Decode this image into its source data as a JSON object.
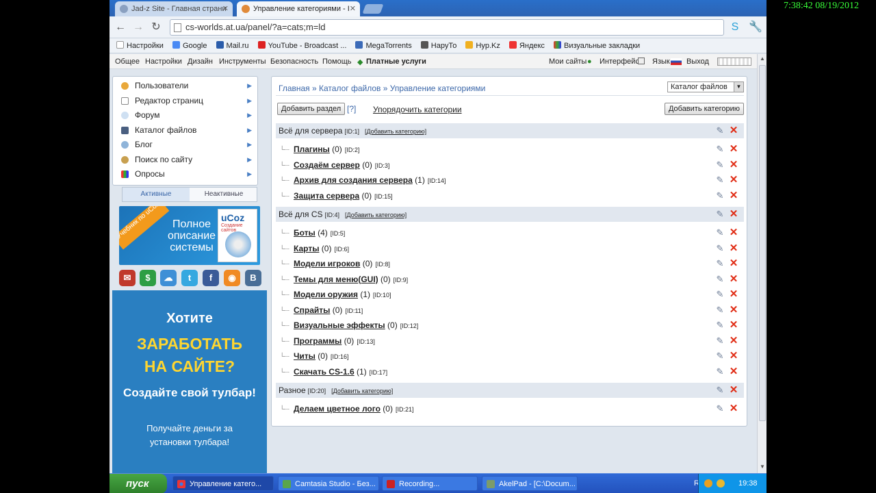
{
  "clock": "7:38:42  08/19/2012",
  "browser": {
    "tabs": [
      {
        "title": "Jad-z Site - Главная страни"
      },
      {
        "title": "Управление категориями - I"
      }
    ],
    "url": "cs-worlds.at.ua/panel/?a=cats;m=ld",
    "bookmarks": [
      "Настройки",
      "Google",
      "Mail.ru",
      "YouTube - Broadcast ...",
      "MegaTorrents",
      "НаруТо",
      "Hyp.Kz",
      "Яндекс",
      "Визуальные закладки"
    ]
  },
  "panelnav": {
    "items": [
      "Общее",
      "Настройки",
      "Дизайн",
      "Инструменты",
      "Безопасность",
      "Помощь"
    ],
    "paid": "Платные услуги",
    "right": [
      "Мои сайты",
      "Интерфейс",
      "Язык",
      "Выход"
    ]
  },
  "leftmenu": {
    "items": [
      "Пользователи",
      "Редактор страниц",
      "Форум",
      "Каталог файлов",
      "Блог",
      "Поиск по сайту",
      "Опросы"
    ],
    "tabs": {
      "active": "Активные",
      "inactive": "Неактивные"
    }
  },
  "banner": {
    "ribbon": "Учебник по uCoz",
    "text": "Полное описание системы",
    "logo": "uCoz",
    "sub": "Создание сайтов"
  },
  "socials": [
    "envelope",
    "dollar",
    "cloud",
    "twitter",
    "f",
    "rss",
    "В"
  ],
  "promo": {
    "line1": "Хотите",
    "line2": "ЗАРАБОТАТЬ",
    "line3": "НА САЙТЕ?",
    "line4": "Создайте свой тулбар!",
    "line5": "Получайте деньги за",
    "line6": "установки тулбара!"
  },
  "main": {
    "crumbs": "Главная » Каталог файлов » Управление категориями",
    "select": "Каталог файлов",
    "add_section": "Добавить раздел",
    "help": "[?]",
    "sort": "Упорядочить категории",
    "add_category": "Добавить категорию",
    "add_link": "[Добавить категорию]",
    "sections": [
      {
        "name": "Всё для сервера",
        "id": "[ID:1]",
        "cats": [
          {
            "name": "Плагины",
            "count": "(0)",
            "id": "[ID:2]"
          },
          {
            "name": "Создаём сервер",
            "count": "(0)",
            "id": "[ID:3]"
          },
          {
            "name": "Архив для создания сервера",
            "count": "(1)",
            "id": "[ID:14]"
          },
          {
            "name": "Защита сервера",
            "count": "(0)",
            "id": "[ID:15]"
          }
        ]
      },
      {
        "name": "Всё для CS",
        "id": "[ID:4]",
        "cats": [
          {
            "name": "Боты",
            "count": "(4)",
            "id": "[ID:5]"
          },
          {
            "name": "Карты",
            "count": "(0)",
            "id": "[ID:6]"
          },
          {
            "name": "Модели игроков",
            "count": "(0)",
            "id": "[ID:8]"
          },
          {
            "name": "Темы для меню(GUI)",
            "count": "(0)",
            "id": "[ID:9]"
          },
          {
            "name": "Модели оружия",
            "count": "(1)",
            "id": "[ID:10]"
          },
          {
            "name": "Спрайты",
            "count": "(0)",
            "id": "[ID:11]"
          },
          {
            "name": "Визуальные эффекты",
            "count": "(0)",
            "id": "[ID:12]"
          },
          {
            "name": "Программы",
            "count": "(0)",
            "id": "[ID:13]"
          },
          {
            "name": "Читы",
            "count": "(0)",
            "id": "[ID:16]"
          },
          {
            "name": "Скачать CS-1.6",
            "count": "(1)",
            "id": "[ID:17]"
          }
        ]
      },
      {
        "name": "Разное",
        "id": "[ID:20]",
        "cats": [
          {
            "name": "Делаем цветное лого",
            "count": "(0)",
            "id": "[ID:21]"
          }
        ]
      }
    ]
  },
  "taskbar": {
    "start": "пуск",
    "tasks": [
      "Управление катего...",
      "Camtasia Studio - Без...",
      "Recording...",
      "AkelPad - [C:\\Docum..."
    ],
    "lang": "RU",
    "time": "19:38"
  }
}
